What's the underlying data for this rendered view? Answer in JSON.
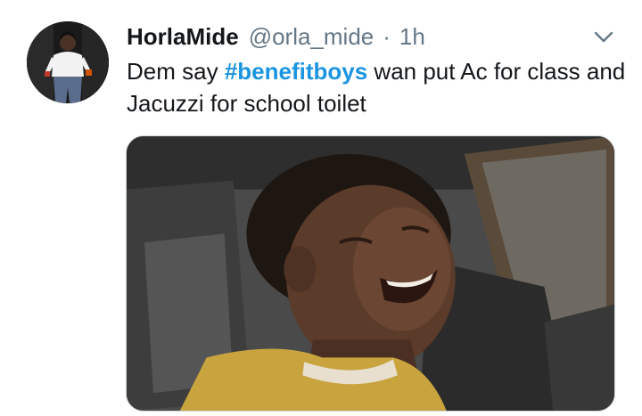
{
  "tweet": {
    "display_name": "HorlaMide",
    "handle": "@orla_mide",
    "separator": "·",
    "timestamp": "1h",
    "text_before": "Dem say ",
    "hashtag": "#benefitboys",
    "text_after": " wan put Ac for class and Jacuzzi for school toilet",
    "menu_icon": "chevron-down-icon",
    "hashtag_color": "#1b95e0",
    "media_description_icon": "video-thumbnail"
  }
}
